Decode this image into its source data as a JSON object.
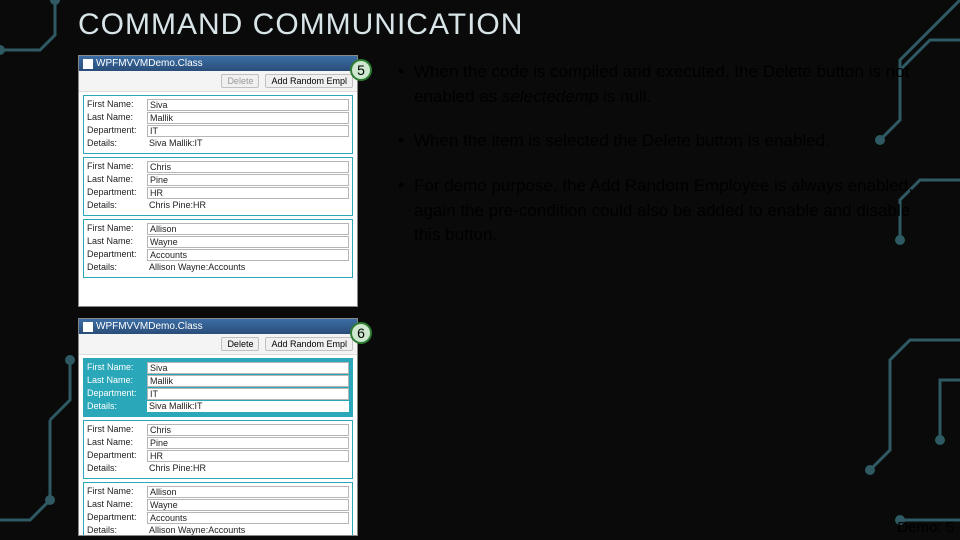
{
  "title": "COMMAND COMMUNICATION",
  "markers": {
    "a": "5",
    "b": "6"
  },
  "bullets": {
    "b1a": "When the code is compiled and executed, the Delete button is not enabled as ",
    "b1b": "selectedemp",
    "b1c": " is null.",
    "b2": "When the item is selected the Delete button is enabled.",
    "b3": "For demo purpose, the Add Random Employee is always enabled, again the pre-condition could also be added to enable and disable this button."
  },
  "window": {
    "title": "WPFMVVMDemo.Class",
    "delete": "Delete",
    "add": "Add Random Empl"
  },
  "labels": {
    "first": "First Name:",
    "last": "Last Name:",
    "dept": "Department:",
    "details": "Details:"
  },
  "employees": [
    {
      "first": "Siva",
      "last": "Mallik",
      "dept": "IT",
      "details": "Siva Mallik:IT"
    },
    {
      "first": "Chris",
      "last": "Pine",
      "dept": "HR",
      "details": "Chris Pine:HR"
    },
    {
      "first": "Allison",
      "last": "Wayne",
      "dept": "Accounts",
      "details": "Allison Wayne:Accounts"
    }
  ],
  "footer": "Demo: 5"
}
